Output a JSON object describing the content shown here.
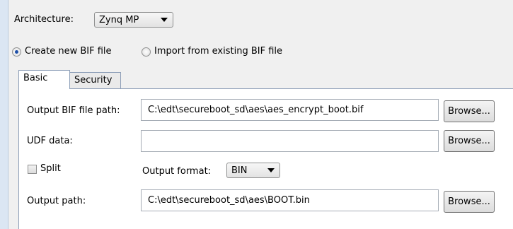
{
  "architecture": {
    "label": "Architecture:",
    "value": "Zynq MP"
  },
  "bif_mode": {
    "options": [
      {
        "label": "Create new BIF file",
        "selected": true
      },
      {
        "label": "Import from existing BIF file",
        "selected": false
      }
    ]
  },
  "tabs": [
    {
      "label": "Basic",
      "active": true
    },
    {
      "label": "Security",
      "active": false
    }
  ],
  "basic": {
    "output_bif": {
      "label": "Output BIF file path:",
      "value": "C:\\edt\\secureboot_sd\\aes\\aes_encrypt_boot.bif"
    },
    "udf": {
      "label": "UDF data:",
      "value": ""
    },
    "split": {
      "label": "Split",
      "checked": false
    },
    "output_format": {
      "label": "Output format:",
      "value": "BIN"
    },
    "output_path": {
      "label": "Output path:",
      "value": "C:\\edt\\secureboot_sd\\aes\\BOOT.bin"
    },
    "browse_label": "Browse..."
  }
}
